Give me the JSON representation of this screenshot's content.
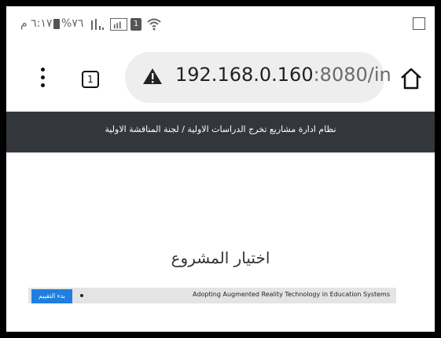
{
  "status_bar": {
    "time": "٦:١٧ م",
    "battery": "%٧٦",
    "sim": "1"
  },
  "browser": {
    "tab_count": "1",
    "url_host": "192.168.0.160",
    "url_rest": ":8080/in"
  },
  "header": {
    "title": "نظام ادارة مشاريع تخرج الدراسات الاولية / لجنة المناقشة الاولية"
  },
  "page": {
    "heading": "اختيار المشروع",
    "project": {
      "title": "Adopting Augmented Reality Technology in Education Systems",
      "button_label": "بدء التقييم"
    }
  },
  "colors": {
    "header_bg": "#33373b",
    "button_bg": "#1e7fe0",
    "row_bg": "#e4e4e4"
  }
}
